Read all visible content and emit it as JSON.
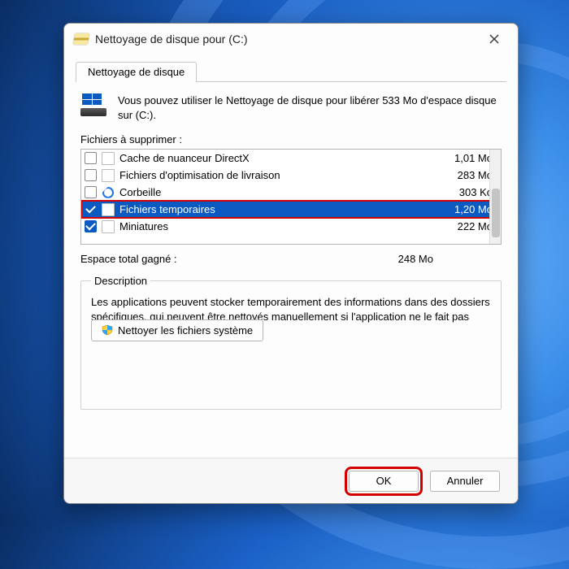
{
  "window": {
    "title": "Nettoyage de disque pour  (C:)"
  },
  "tab": {
    "label": "Nettoyage de disque"
  },
  "intro": {
    "text": "Vous pouvez utiliser le Nettoyage de disque pour libérer 533 Mo d'espace disque sur  (C:)."
  },
  "files": {
    "label": "Fichiers à supprimer :",
    "items": [
      {
        "label": "Cache de nuanceur DirectX",
        "size": "1,01 Mo",
        "checked": false,
        "icon": "file",
        "selected": false,
        "highlight": false
      },
      {
        "label": "Fichiers d'optimisation de livraison",
        "size": "283 Mo",
        "checked": false,
        "icon": "file",
        "selected": false,
        "highlight": false
      },
      {
        "label": "Corbeille",
        "size": "303 Ko",
        "checked": false,
        "icon": "recycle",
        "selected": false,
        "highlight": false
      },
      {
        "label": "Fichiers temporaires",
        "size": "1,20 Mo",
        "checked": true,
        "icon": "file",
        "selected": true,
        "highlight": true
      },
      {
        "label": "Miniatures",
        "size": "222 Mo",
        "checked": true,
        "icon": "file",
        "selected": false,
        "highlight": false
      }
    ]
  },
  "total": {
    "label": "Espace total gagné :",
    "value": "248 Mo"
  },
  "description": {
    "legend": "Description",
    "text": "Les applications peuvent stocker temporairement des informations dans des dossiers spécifiques, qui peuvent être nettoyés manuellement si l'application ne le fait pas automatiquement."
  },
  "sys_clean_button": "Nettoyer les fichiers système",
  "buttons": {
    "ok": "OK",
    "cancel": "Annuler"
  }
}
